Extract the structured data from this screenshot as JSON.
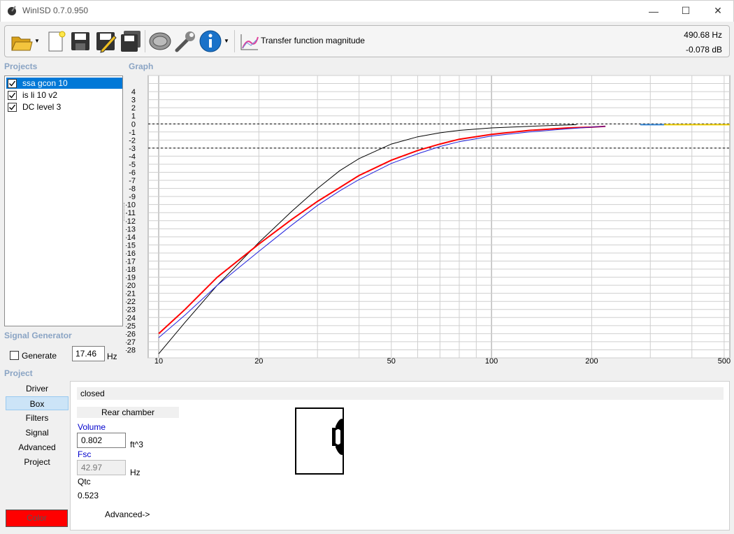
{
  "window": {
    "title": "WinISD 0.7.0.950",
    "controls": {
      "minimize": "—",
      "maximize": "☐",
      "close": "✕"
    }
  },
  "toolbar": {
    "buttons": [
      "open-folder-icon",
      "new-document-icon",
      "save-icon",
      "edit-icon",
      "save-all-icon",
      "driver-icon",
      "tools-icon",
      "info-icon",
      "graph-icon"
    ],
    "transfer_label": "Transfer function magnitude",
    "readout_hz": "490.68 Hz",
    "readout_db": "-0.078 dB"
  },
  "projects": {
    "label": "Projects",
    "items": [
      {
        "name": "ssa gcon 10",
        "checked": true,
        "selected": true
      },
      {
        "name": "is li 10 v2",
        "checked": true,
        "selected": false
      },
      {
        "name": "DC level 3",
        "checked": true,
        "selected": false
      }
    ]
  },
  "signal_generator": {
    "label": "Signal Generator",
    "generate_label": "Generate",
    "frequency": "17.46",
    "unit": "Hz"
  },
  "graph": {
    "label": "Graph"
  },
  "chart_data": {
    "type": "line",
    "title": "",
    "xlabel": "",
    "ylabel": "",
    "x_scale": "log",
    "xlim": [
      9.3,
      520
    ],
    "ylim": [
      -29,
      6
    ],
    "x_ticks": [
      10,
      20,
      50,
      100,
      200,
      500
    ],
    "y_ticks": [
      4,
      3,
      2,
      1,
      0,
      -1,
      -2,
      -3,
      -4,
      -5,
      -6,
      -7,
      -8,
      -9,
      -10,
      -11,
      -12,
      -13,
      -14,
      -15,
      -16,
      -17,
      -18,
      -19,
      -20,
      -21,
      -22,
      -23,
      -24,
      -25,
      -26,
      -27,
      -28
    ],
    "reference_lines": [
      0,
      -3
    ],
    "grid": true,
    "series": [
      {
        "color": "#000000",
        "x": [
          10,
          12,
          15,
          20,
          25,
          30,
          35,
          40,
          50,
          60,
          70,
          80,
          100,
          130,
          180
        ],
        "y": [
          -28.5,
          -24.6,
          -20,
          -14.7,
          -10.9,
          -8,
          -5.8,
          -4.3,
          -2.5,
          -1.6,
          -1.1,
          -0.8,
          -0.5,
          -0.3,
          -0.1
        ]
      },
      {
        "color": "#ff0000",
        "x": [
          10,
          12,
          15,
          20,
          25,
          30,
          35,
          40,
          50,
          60,
          70,
          80,
          100,
          130,
          170,
          200,
          220
        ],
        "y": [
          -26,
          -23,
          -19,
          -14.9,
          -11.9,
          -9.6,
          -7.9,
          -6.4,
          -4.5,
          -3.3,
          -2.5,
          -1.9,
          -1.3,
          -0.8,
          -0.5,
          -0.4,
          -0.3
        ]
      },
      {
        "color": "#2222dd",
        "x": [
          10,
          12,
          15,
          20,
          25,
          30,
          35,
          40,
          50,
          60,
          70,
          80,
          100,
          130,
          170,
          200,
          220
        ],
        "y": [
          -26.5,
          -23.7,
          -20,
          -15.8,
          -12.6,
          -10.1,
          -8.3,
          -6.9,
          -4.9,
          -3.7,
          -2.8,
          -2.2,
          -1.5,
          -1,
          -0.6,
          -0.4,
          -0.3
        ]
      }
    ]
  },
  "project_nav": {
    "label": "Project",
    "items": [
      "Driver",
      "Box",
      "Filters",
      "Signal",
      "Advanced",
      "Project"
    ],
    "selected": "Box",
    "color_label": "Color",
    "color_value": "#ff0000"
  },
  "box": {
    "type": "closed",
    "chamber_label": "Rear chamber",
    "volume_label": "Volume",
    "volume_value": "0.802",
    "volume_unit": "ft^3",
    "fsc_label": "Fsc",
    "fsc_value": "42.97",
    "fsc_unit": "Hz",
    "qtc_label": "Qtc",
    "qtc_value": "0.523",
    "advanced_label": "Advanced->"
  }
}
